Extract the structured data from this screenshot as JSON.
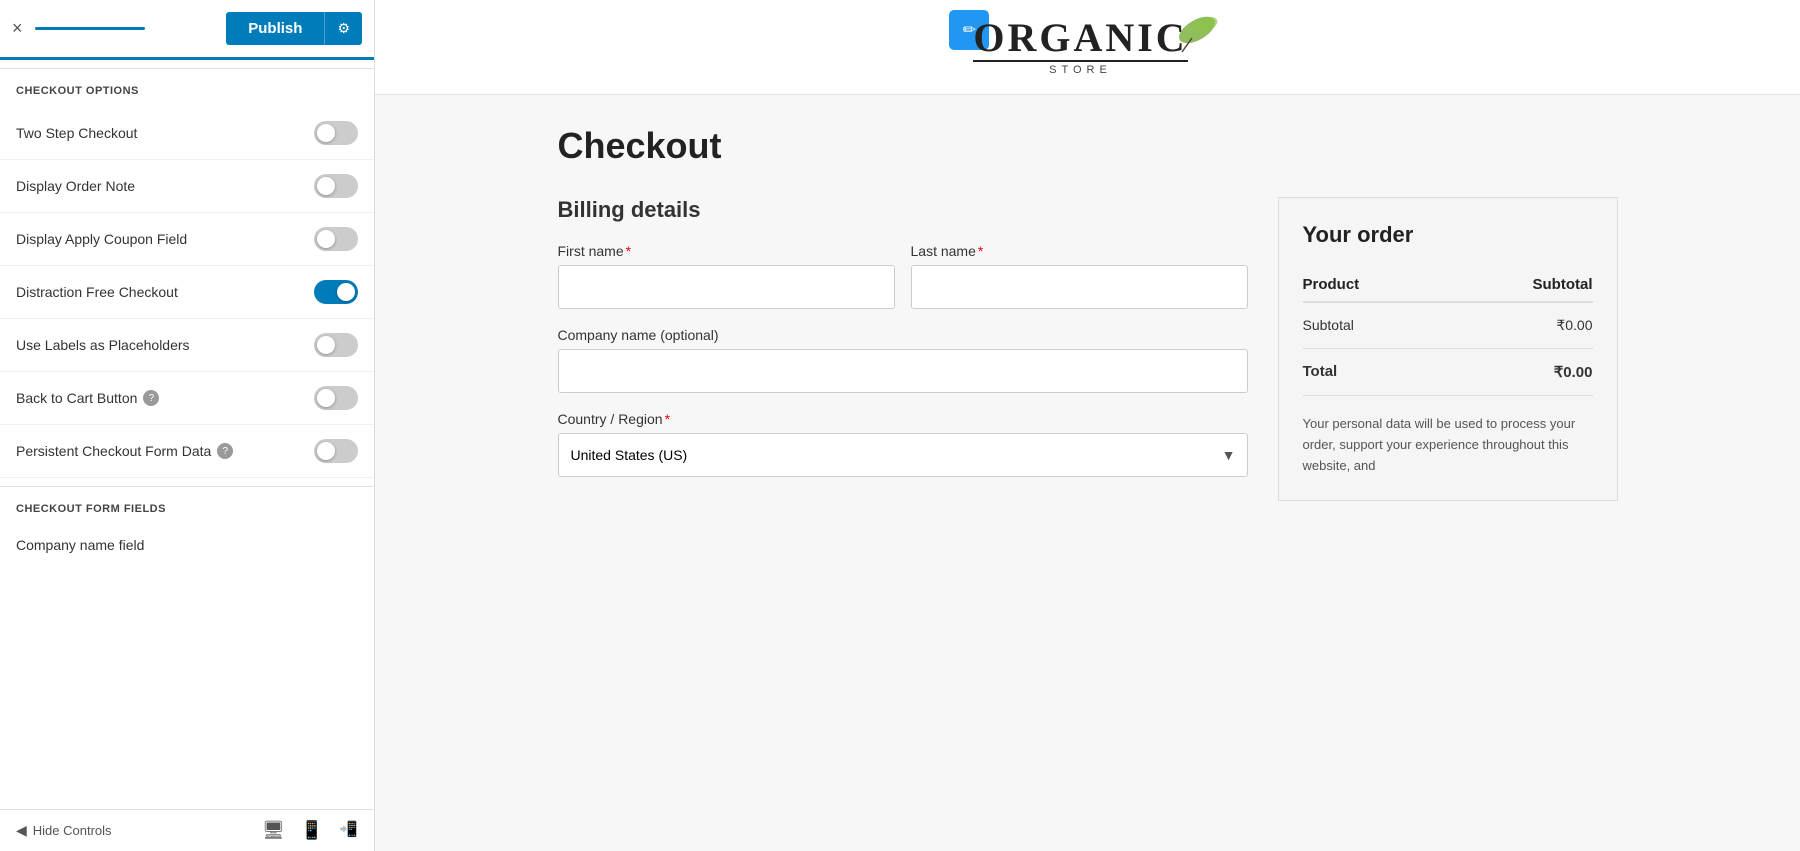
{
  "topbar": {
    "close_label": "×",
    "publish_label": "Publish",
    "settings_icon": "⚙"
  },
  "checkout_options": {
    "section_header": "CHECKOUT OPTIONS",
    "options": [
      {
        "id": "two-step",
        "label": "Two Step Checkout",
        "checked": false,
        "has_help": false
      },
      {
        "id": "display-order-note",
        "label": "Display Order Note",
        "checked": false,
        "has_help": false
      },
      {
        "id": "display-apply-coupon",
        "label": "Display Apply Coupon Field",
        "checked": false,
        "has_help": false
      },
      {
        "id": "distraction-free",
        "label": "Distraction Free Checkout",
        "checked": true,
        "has_help": false
      },
      {
        "id": "use-labels",
        "label": "Use Labels as Placeholders",
        "checked": false,
        "has_help": false
      },
      {
        "id": "back-to-cart",
        "label": "Back to Cart Button",
        "checked": false,
        "has_help": true
      },
      {
        "id": "persistent-form",
        "label": "Persistent Checkout Form Data",
        "checked": false,
        "has_help": true
      }
    ]
  },
  "checkout_form_fields": {
    "section_header": "CHECKOUT FORM FIELDS",
    "subsection_label": "Company name field"
  },
  "bottom_bar": {
    "hide_controls_label": "Hide Controls",
    "icons": [
      "desktop",
      "tablet",
      "mobile"
    ]
  },
  "site": {
    "logo_text_organic": "Organic",
    "logo_text_store": "STORE",
    "checkout_page_title": "Checkout",
    "billing_details_title": "Billing details",
    "fields": {
      "first_name_label": "First name",
      "last_name_label": "Last name",
      "company_label": "Company name (optional)",
      "country_label": "Country / Region",
      "country_value": "United States (US)"
    },
    "order_summary": {
      "title": "Your order",
      "product_col": "Product",
      "subtotal_col": "Subtotal",
      "subtotal_label": "Subtotal",
      "subtotal_value": "₹0.00",
      "total_label": "Total",
      "total_value": "₹0.00",
      "privacy_text": "Your personal data will be used to process your order, support your experience throughout this website, and"
    }
  }
}
